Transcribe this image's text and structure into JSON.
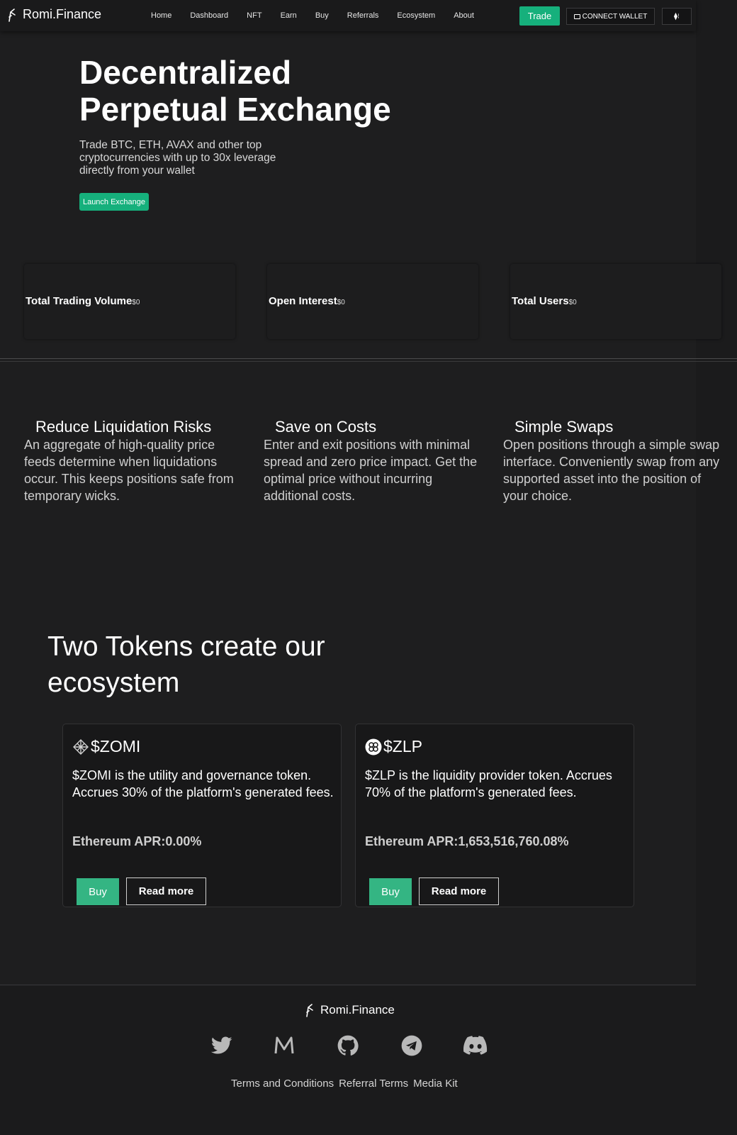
{
  "nav": {
    "brand": "Romi.Finance",
    "links": [
      "Home",
      "Dashboard",
      "NFT",
      "Earn",
      "Buy",
      "Referrals",
      "Ecosystem",
      "About"
    ],
    "trade_label": "Trade",
    "wallet_label": "CONNECT WALLET",
    "network_label": "⧫⁝"
  },
  "hero": {
    "title_line1": "Decentralized",
    "title_line2": "Perpetual Exchange",
    "subtitle": "Trade BTC, ETH, AVAX and other top cryptocurrencies with up to 30x leverage directly from your wallet",
    "cta_label": "Launch Exchange"
  },
  "stats": [
    {
      "label": "Total Trading Volume",
      "value": "$0"
    },
    {
      "label": "Open Interest",
      "value": "$0"
    },
    {
      "label": "Total Users",
      "value": "$0"
    }
  ],
  "features": [
    {
      "title": "Reduce Liquidation Risks",
      "text": "An aggregate of high-quality price feeds determine when liquidations occur. This keeps positions safe from temporary wicks."
    },
    {
      "title": "Save on Costs",
      "text": "Enter and exit positions with minimal spread and zero price impact. Get the optimal price without incurring additional costs."
    },
    {
      "title": "Simple Swaps",
      "text": "Open positions through a simple swap interface. Conveniently swap from any supported asset into the position of your choice."
    }
  ],
  "tokens_section": {
    "title": "Two Tokens create our ecosystem"
  },
  "tokens": [
    {
      "name": "$ZOMI",
      "icon": "zomi-token-icon",
      "description": "$ZOMI is the utility and governance token. Accrues 30% of the platform's generated fees.",
      "apr": "Ethereum APR:0.00%",
      "buy_label": "Buy",
      "more_label": "Read more"
    },
    {
      "name": "$ZLP",
      "icon": "zlp-token-icon",
      "description": "$ZLP is the liquidity provider token. Accrues 70% of the platform's generated fees.",
      "apr": "Ethereum APR:1,653,516,760.08%",
      "buy_label": "Buy",
      "more_label": "Read more"
    }
  ],
  "footer": {
    "brand": "Romi.Finance",
    "socials": [
      "twitter-icon",
      "medium-icon",
      "github-icon",
      "telegram-icon",
      "discord-icon"
    ],
    "links": [
      "Terms and Conditions",
      "Referral Terms",
      "Media Kit"
    ]
  },
  "colors": {
    "background": "#1e1e1f",
    "accent": "#16b07c",
    "buy_button": "#34b583"
  }
}
